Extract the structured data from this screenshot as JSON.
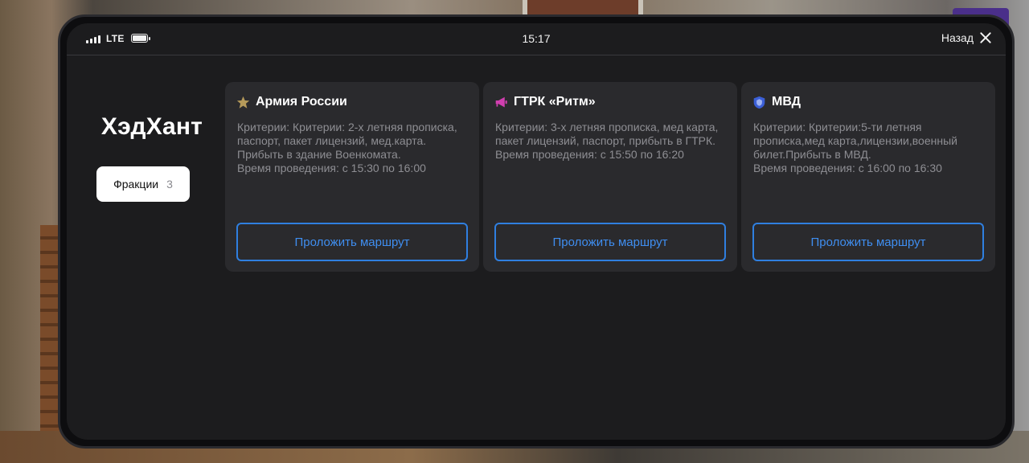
{
  "status_bar": {
    "network": "LTE",
    "time": "15:17",
    "back_label": "Назад",
    "icons": [
      "signal-icon",
      "battery-icon",
      "close-icon"
    ]
  },
  "sidebar": {
    "title": "ХэдХант",
    "tab": {
      "label": "Фракции",
      "count": "3"
    }
  },
  "cards": [
    {
      "icon": "star-icon",
      "icon_color": "#b59a5a",
      "title": "Армия России",
      "lines": [
        "Критерии: Критерии: 2-х летняя прописка,",
        "паспорт, пакет лицензий, мед.карта.",
        "Прибыть в здание Военкомата.",
        "Время проведения: с 15:30 по 16:00"
      ],
      "button": "Проложить маршрут"
    },
    {
      "icon": "megaphone-icon",
      "icon_color": "#d13fb0",
      "title": "ГТРК «Ритм»",
      "lines": [
        "Критерии: 3-х летняя прописка, мед карта,",
        "пакет лицензий, паспорт, прибыть в ГТРК.",
        "Время проведения: с 15:50 по 16:20"
      ],
      "button": "Проложить маршрут"
    },
    {
      "icon": "police-shield-icon",
      "icon_color": "#3b5fd6",
      "title": "МВД",
      "lines": [
        "Критерии: Критерии:5-ти летняя",
        "прописка,мед карта,лицензии,военный",
        "билет.Прибыть в МВД.",
        "Время проведения: с 16:00 по 16:30"
      ],
      "button": "Проложить маршрут"
    }
  ],
  "colors": {
    "screen_bg": "#1c1c1e",
    "card_bg": "#2a2a2d",
    "accent": "#2f7fe0",
    "text_muted": "#8e8e93"
  }
}
